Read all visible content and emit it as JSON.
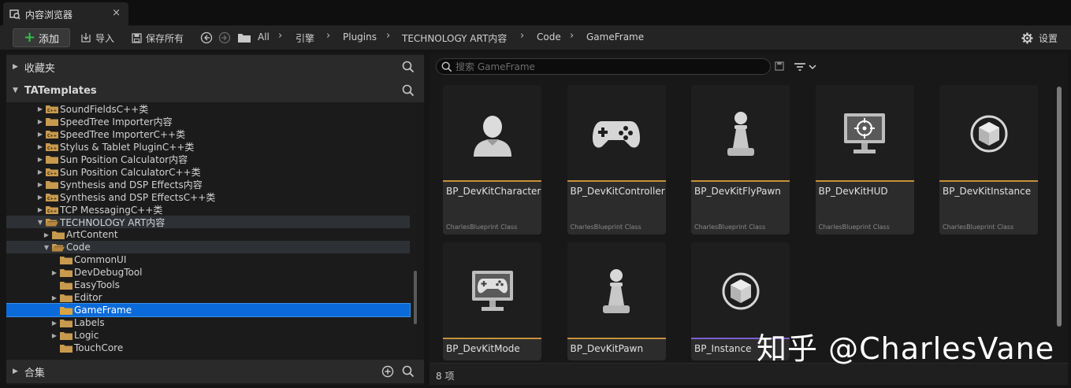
{
  "tab": {
    "label": "内容浏览器",
    "close": "×"
  },
  "toolbar": {
    "add_label": "添加",
    "import_label": "导入",
    "save_all_label": "保存所有",
    "settings_label": "设置",
    "breadcrumbs": [
      "All",
      "引擎",
      "Plugins",
      "TECHNOLOGY ART内容",
      "Code",
      "GameFrame"
    ]
  },
  "left": {
    "favorites_label": "收藏夹",
    "project_label": "TATemplates",
    "collections_label": "合集",
    "tree": [
      {
        "label": "SoundFieldsC++类",
        "cpp": true,
        "depth": 1,
        "expand": "▶"
      },
      {
        "label": "SpeedTree Importer内容",
        "cpp": false,
        "depth": 1,
        "expand": "▶"
      },
      {
        "label": "SpeedTree ImporterC++类",
        "cpp": true,
        "depth": 1,
        "expand": "▶"
      },
      {
        "label": "Stylus & Tablet PluginC++类",
        "cpp": true,
        "depth": 1,
        "expand": "▶"
      },
      {
        "label": "Sun Position Calculator内容",
        "cpp": false,
        "depth": 1,
        "expand": "▶"
      },
      {
        "label": "Sun Position CalculatorC++类",
        "cpp": true,
        "depth": 1,
        "expand": "▶"
      },
      {
        "label": "Synthesis and DSP Effects内容",
        "cpp": false,
        "depth": 1,
        "expand": "▶"
      },
      {
        "label": "Synthesis and DSP EffectsC++类",
        "cpp": true,
        "depth": 1,
        "expand": "▶"
      },
      {
        "label": "TCP MessagingC++类",
        "cpp": true,
        "depth": 1,
        "expand": "▶"
      },
      {
        "label": "TECHNOLOGY ART内容",
        "cpp": false,
        "depth": 1,
        "expand": "▼",
        "open": true,
        "hl": true
      },
      {
        "label": "ArtContent",
        "cpp": false,
        "depth": 2,
        "expand": "▶"
      },
      {
        "label": "Code",
        "cpp": false,
        "depth": 2,
        "expand": "▼",
        "open": true,
        "hl": true
      },
      {
        "label": "CommonUI",
        "cpp": false,
        "depth": 3,
        "expand": ""
      },
      {
        "label": "DevDebugTool",
        "cpp": false,
        "depth": 3,
        "expand": "▶"
      },
      {
        "label": "EasyTools",
        "cpp": false,
        "depth": 3,
        "expand": ""
      },
      {
        "label": "Editor",
        "cpp": false,
        "depth": 3,
        "expand": "▶"
      },
      {
        "label": "GameFrame",
        "cpp": false,
        "depth": 3,
        "expand": "",
        "sel": true
      },
      {
        "label": "Labels",
        "cpp": false,
        "depth": 3,
        "expand": "▶"
      },
      {
        "label": "Logic",
        "cpp": false,
        "depth": 3,
        "expand": "▶"
      },
      {
        "label": "TouchCore",
        "cpp": false,
        "depth": 3,
        "expand": ""
      }
    ]
  },
  "right": {
    "search_placeholder": "搜索 GameFrame",
    "status": "8 项",
    "assets": [
      {
        "name": "BP_DevKitCharacter",
        "type": "CharlesBlueprint Class",
        "icon": "character-icon"
      },
      {
        "name": "BP_DevKitController",
        "type": "CharlesBlueprint Class",
        "icon": "gamepad-icon"
      },
      {
        "name": "BP_DevKitFlyPawn",
        "type": "CharlesBlueprint Class",
        "icon": "pawn-icon"
      },
      {
        "name": "BP_DevKitHUD",
        "type": "CharlesBlueprint Class",
        "icon": "hud-icon"
      },
      {
        "name": "BP_DevKitInstance",
        "type": "CharlesBlueprint Class",
        "icon": "cube-icon"
      },
      {
        "name": "BP_DevKitMode",
        "type": "",
        "icon": "game-mode-icon"
      },
      {
        "name": "BP_DevKitPawn",
        "type": "",
        "icon": "pawn-icon"
      },
      {
        "name": "BP_Instance",
        "type": "",
        "icon": "cube-icon"
      }
    ]
  },
  "watermark": "知乎 @CharlesVane",
  "colors": {
    "accent_bar": "#c6913a",
    "selected_row": "#0b6ad9",
    "add_plus": "#2fbf4a",
    "instance_bar": "#7d5fd0"
  }
}
